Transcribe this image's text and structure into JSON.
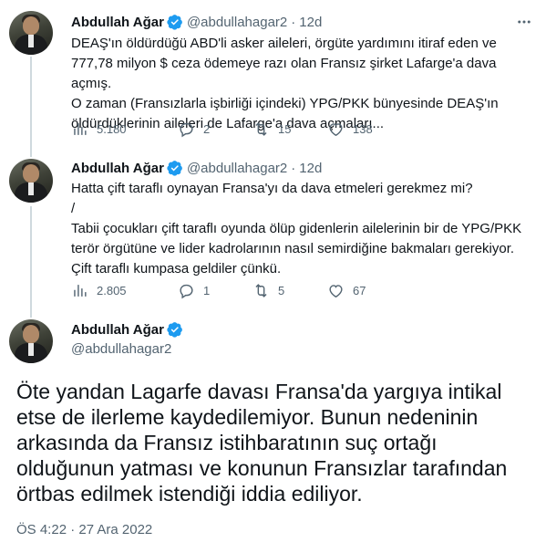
{
  "tweets": [
    {
      "name": "Abdullah Ağar",
      "handle": "@abdullahagar2",
      "time": "12d",
      "text": "DEAŞ'ın öldürdüğü ABD'li asker aileleri, örgüte yardımını itiraf eden ve\n777,78 milyon $ ceza ödemeye razı olan Fransız şirket Lafarge'a dava açmış.\nO zaman (Fransızlarla işbirliği içindeki) YPG/PKK bünyesinde DEAŞ'ın\nöldürdüklerinin aileleri de Lafarge'a dava açmaları...",
      "views": "5.180",
      "replies": "2",
      "retweets": "15",
      "likes": "138"
    },
    {
      "name": "Abdullah Ağar",
      "handle": "@abdullahagar2",
      "time": "12d",
      "text": "Hatta çift taraflı oynayan Fransa'yı da dava etmeleri gerekmez mi?\n/\nTabii çocukları çift taraflı oyunda ölüp gidenlerin ailelerinin bir de YPG/PKK\nterör örgütüne ve lider kadrolarının nasıl semirdiğine bakmaları gerekiyor.\nÇift taraflı kumpasa geldiler çünkü.",
      "views": "2.805",
      "replies": "1",
      "retweets": "5",
      "likes": "67"
    }
  ],
  "main": {
    "name": "Abdullah Ağar",
    "handle": "@abdullahagar2",
    "text": "Öte yandan Lagarfe davası Fransa'da yargıya intikal\netse de ilerleme kaydedilemiyor. Bunun nedeninin\narkasında da Fransız istihbaratının suç ortağı\nolduğunun yatması ve konunun Fransızlar tarafından\nörtbas edilmek istendiği iddia ediliyor.",
    "date": "ÖS 4:22 · 27 Ara 2022"
  },
  "icons": {
    "verified": "verified-badge-icon",
    "more": "more-dots-icon",
    "views": "analytics-icon",
    "reply": "reply-icon",
    "retweet": "retweet-icon",
    "like": "heart-icon"
  },
  "colors": {
    "accent": "#1d9bf0",
    "secondary_text": "#536471",
    "thread_line": "#cfd9de"
  }
}
